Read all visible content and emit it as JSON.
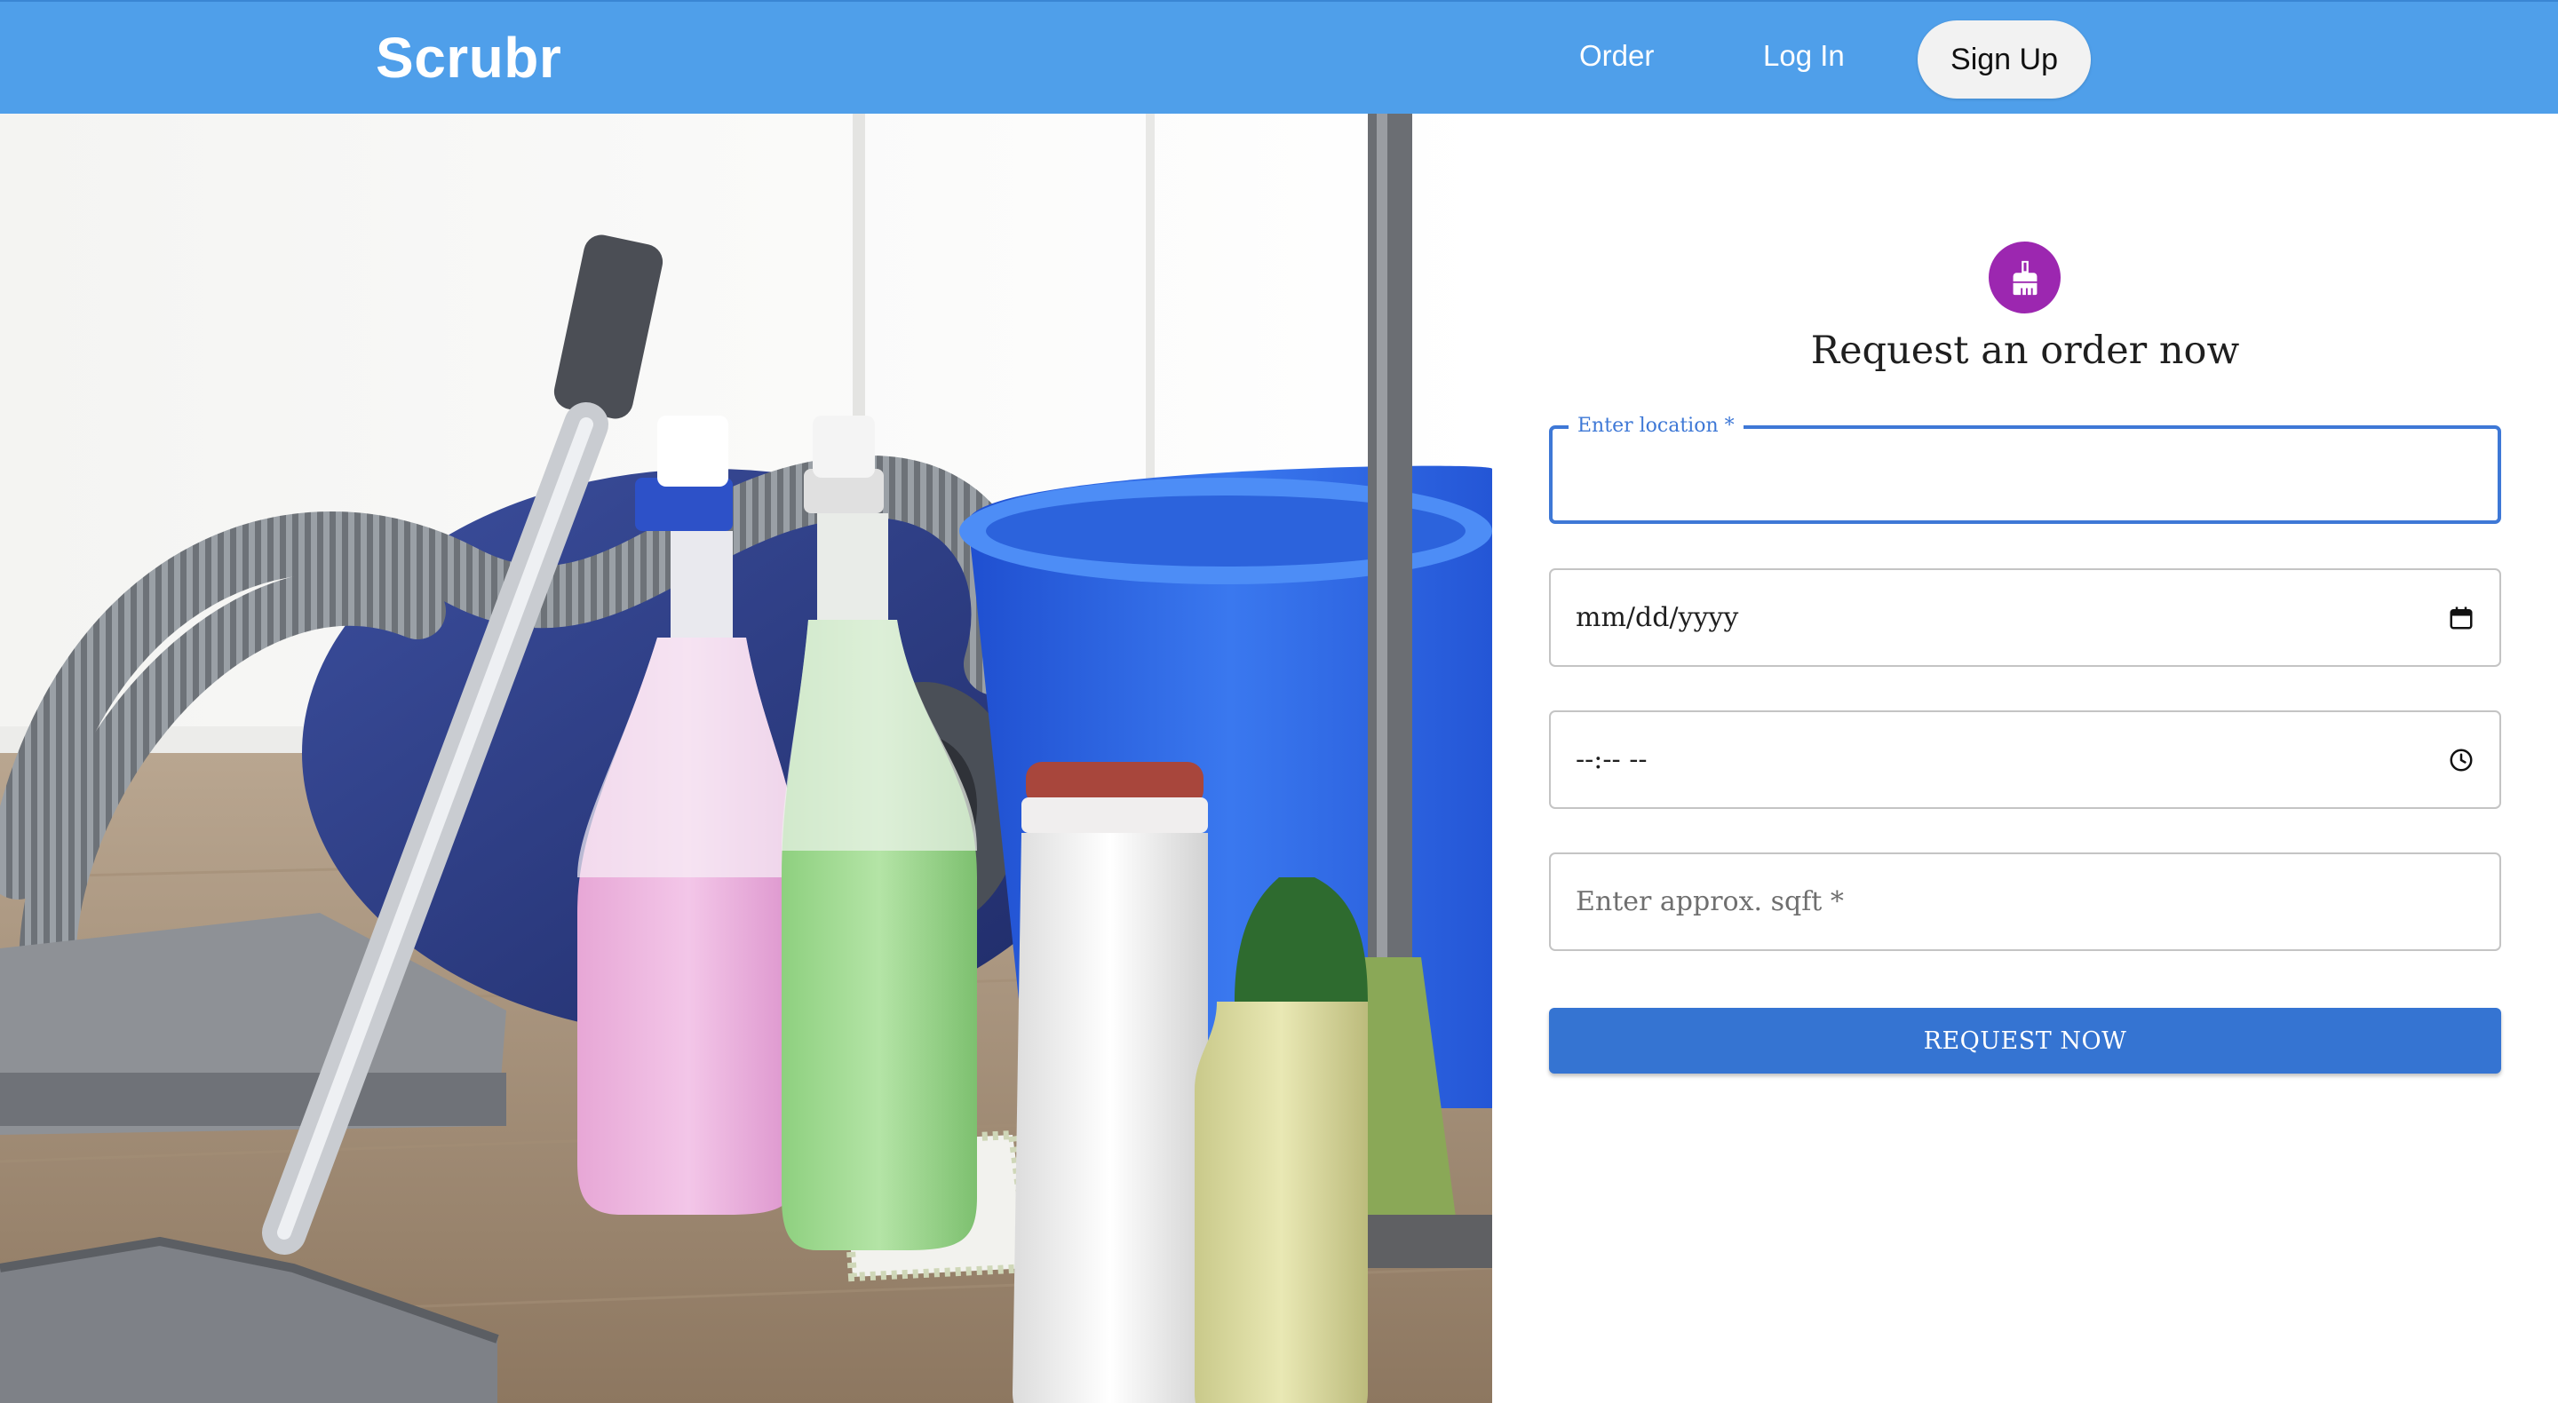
{
  "navbar": {
    "brand": "Scrubr",
    "links": {
      "order": "Order",
      "login": "Log In",
      "signup": "Sign Up"
    },
    "colors": {
      "background": "#4f9fea",
      "signup_bg": "#f2f2f2"
    }
  },
  "hero": {
    "image": "cleaning-supplies-photo",
    "icons": [
      "vacuum-cleaner",
      "spray-bottle",
      "bucket",
      "mop",
      "detergent-bottle"
    ]
  },
  "form": {
    "avatar_icon": "broom-icon",
    "title": "Request an order now",
    "location": {
      "label": "Enter location *",
      "value": ""
    },
    "date": {
      "placeholder": "mm/dd/yyyy",
      "icon": "calendar-icon"
    },
    "time": {
      "placeholder": "--:-- --",
      "icon": "clock-icon"
    },
    "sqft": {
      "placeholder": "Enter approx. sqft *"
    },
    "submit_label": "REQUEST NOW",
    "colors": {
      "accent": "#3e78d6",
      "button": "#3574d2",
      "avatar": "#9c27b0"
    }
  }
}
